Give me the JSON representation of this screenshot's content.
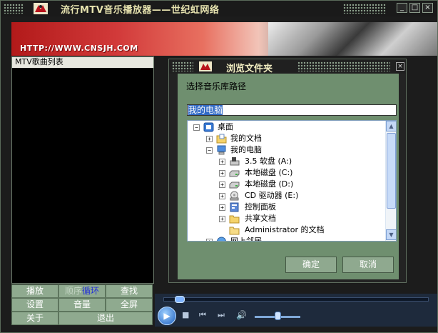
{
  "app": {
    "title": "流行MTV音乐播放器——世纪虹网络",
    "banner_url": "HTTP://WWW.CNSJH.COM",
    "window_buttons": [
      "_",
      "□",
      "×"
    ]
  },
  "playlist": {
    "header": "MTV歌曲列表"
  },
  "controls": {
    "play": "播放",
    "mode_prefix": "顺序",
    "mode_suffix": "循环",
    "search": "查找",
    "settings": "设置",
    "volume": "音量",
    "fullscreen": "全屏",
    "about": "关于",
    "exit": "退出"
  },
  "dialog": {
    "title": "浏览文件夹",
    "close": "×",
    "prompt": "选择音乐库路径",
    "path_value": "我的电脑",
    "tree": [
      {
        "label": "桌面",
        "expander": "−",
        "icon": "desktop-icon"
      },
      {
        "label": "我的文档",
        "expander": "+",
        "icon": "my-documents-icon"
      },
      {
        "label": "我的电脑",
        "expander": "−",
        "icon": "my-computer-icon"
      },
      {
        "label": "3.5 软盘 (A:)",
        "expander": "+",
        "icon": "floppy-drive-icon"
      },
      {
        "label": "本地磁盘 (C:)",
        "expander": "+",
        "icon": "hard-disk-icon"
      },
      {
        "label": "本地磁盘 (D:)",
        "expander": "+",
        "icon": "hard-disk-icon"
      },
      {
        "label": "CD 驱动器 (E:)",
        "expander": "+",
        "icon": "cd-drive-icon"
      },
      {
        "label": "控制面板",
        "expander": "+",
        "icon": "control-panel-icon"
      },
      {
        "label": "共享文档",
        "expander": "+",
        "icon": "shared-folder-icon"
      },
      {
        "label": "Administrator 的文档",
        "expander": "",
        "icon": "folder-icon"
      },
      {
        "label": "网上邻居",
        "expander": "+",
        "icon": "network-places-icon"
      }
    ],
    "ok": "确定",
    "cancel": "取消"
  },
  "player": {
    "play_glyph": "▶",
    "stop_glyph": "■",
    "prev_glyph": "⏮",
    "next_glyph": "⏭",
    "volume_glyph": "🔊"
  },
  "colors": {
    "panel_green": "#8faa8f",
    "dialog_green": "#6f8f6f",
    "selection_blue": "#316ac5"
  }
}
